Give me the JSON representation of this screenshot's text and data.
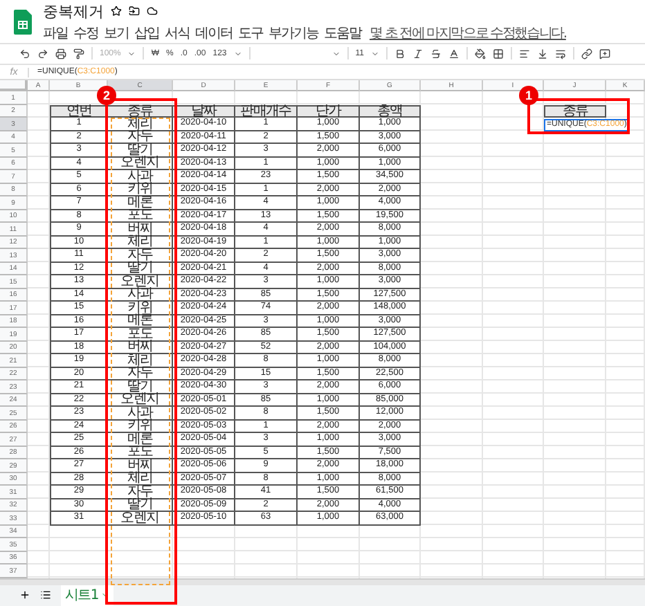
{
  "document": {
    "title": "중복제거"
  },
  "menu": [
    "파일",
    "수정",
    "보기",
    "삽입",
    "서식",
    "데이터",
    "도구",
    "부가기능",
    "도움말"
  ],
  "last_edit": "몇 초 전에 마지막으로 수정했습니다.",
  "toolbar": {
    "zoom": "100%",
    "currency": "₩",
    "percent": "%",
    "decrease_decimal": ".0",
    "increase_decimal": ".00",
    "number_format": "123",
    "font_size": "11"
  },
  "formula_bar": {
    "label": "fx",
    "formula": {
      "prefix": "=UNIQUE(",
      "range": "C3:C1000",
      "suffix": ")"
    }
  },
  "columns": [
    {
      "label": "A",
      "highlighted": false
    },
    {
      "label": "B",
      "highlighted": false
    },
    {
      "label": "C",
      "highlighted": true
    },
    {
      "label": "D",
      "highlighted": false
    },
    {
      "label": "E",
      "highlighted": false
    },
    {
      "label": "F",
      "highlighted": false
    },
    {
      "label": "G",
      "highlighted": false
    },
    {
      "label": "H",
      "highlighted": false
    },
    {
      "label": "I",
      "highlighted": false
    },
    {
      "label": "J",
      "highlighted": false
    },
    {
      "label": "K",
      "highlighted": false
    }
  ],
  "row_numbers": [
    {
      "label": "1",
      "highlighted": false
    },
    {
      "label": "2",
      "highlighted": false
    },
    {
      "label": "3",
      "highlighted": true
    },
    {
      "label": "4",
      "highlighted": false
    },
    {
      "label": "5",
      "highlighted": false
    },
    {
      "label": "6",
      "highlighted": false
    },
    {
      "label": "7",
      "highlighted": false
    },
    {
      "label": "8",
      "highlighted": false
    },
    {
      "label": "9",
      "highlighted": false
    },
    {
      "label": "10",
      "highlighted": false
    },
    {
      "label": "11",
      "highlighted": false
    },
    {
      "label": "12",
      "highlighted": false
    },
    {
      "label": "13",
      "highlighted": false
    },
    {
      "label": "14",
      "highlighted": false
    },
    {
      "label": "15",
      "highlighted": false
    },
    {
      "label": "16",
      "highlighted": false
    },
    {
      "label": "17",
      "highlighted": false
    },
    {
      "label": "18",
      "highlighted": false
    },
    {
      "label": "19",
      "highlighted": false
    },
    {
      "label": "20",
      "highlighted": false
    },
    {
      "label": "21",
      "highlighted": false
    },
    {
      "label": "22",
      "highlighted": false
    },
    {
      "label": "23",
      "highlighted": false
    },
    {
      "label": "24",
      "highlighted": false
    },
    {
      "label": "25",
      "highlighted": false
    },
    {
      "label": "26",
      "highlighted": false
    },
    {
      "label": "27",
      "highlighted": false
    },
    {
      "label": "28",
      "highlighted": false
    },
    {
      "label": "29",
      "highlighted": false
    },
    {
      "label": "30",
      "highlighted": false
    },
    {
      "label": "31",
      "highlighted": false
    },
    {
      "label": "32",
      "highlighted": false
    },
    {
      "label": "33",
      "highlighted": false
    },
    {
      "label": "34",
      "highlighted": false
    },
    {
      "label": "35",
      "highlighted": false
    },
    {
      "label": "36",
      "highlighted": false
    },
    {
      "label": "37",
      "highlighted": false
    }
  ],
  "table": {
    "columns": [
      "연번",
      "종류",
      "날짜",
      "판매개수",
      "단가",
      "총액"
    ],
    "rows": [
      [
        "1",
        "체리",
        "2020-04-10",
        "1",
        "1,000",
        "1,000"
      ],
      [
        "2",
        "자두",
        "2020-04-11",
        "2",
        "1,500",
        "3,000"
      ],
      [
        "3",
        "딸기",
        "2020-04-12",
        "3",
        "2,000",
        "6,000"
      ],
      [
        "4",
        "오렌지",
        "2020-04-13",
        "1",
        "1,000",
        "1,000"
      ],
      [
        "5",
        "사과",
        "2020-04-14",
        "23",
        "1,500",
        "34,500"
      ],
      [
        "6",
        "키위",
        "2020-04-15",
        "1",
        "2,000",
        "2,000"
      ],
      [
        "7",
        "메론",
        "2020-04-16",
        "4",
        "1,000",
        "4,000"
      ],
      [
        "8",
        "포도",
        "2020-04-17",
        "13",
        "1,500",
        "19,500"
      ],
      [
        "9",
        "버찌",
        "2020-04-18",
        "4",
        "2,000",
        "8,000"
      ],
      [
        "10",
        "체리",
        "2020-04-19",
        "1",
        "1,000",
        "1,000"
      ],
      [
        "11",
        "자두",
        "2020-04-20",
        "2",
        "1,500",
        "3,000"
      ],
      [
        "12",
        "딸기",
        "2020-04-21",
        "4",
        "2,000",
        "8,000"
      ],
      [
        "13",
        "오렌지",
        "2020-04-22",
        "3",
        "1,000",
        "3,000"
      ],
      [
        "14",
        "사과",
        "2020-04-23",
        "85",
        "1,500",
        "127,500"
      ],
      [
        "15",
        "키위",
        "2020-04-24",
        "74",
        "2,000",
        "148,000"
      ],
      [
        "16",
        "메론",
        "2020-04-25",
        "3",
        "1,000",
        "3,000"
      ],
      [
        "17",
        "포도",
        "2020-04-26",
        "85",
        "1,500",
        "127,500"
      ],
      [
        "18",
        "버찌",
        "2020-04-27",
        "52",
        "2,000",
        "104,000"
      ],
      [
        "19",
        "체리",
        "2020-04-28",
        "8",
        "1,000",
        "8,000"
      ],
      [
        "20",
        "자두",
        "2020-04-29",
        "15",
        "1,500",
        "22,500"
      ],
      [
        "21",
        "딸기",
        "2020-04-30",
        "3",
        "2,000",
        "6,000"
      ],
      [
        "22",
        "오렌지",
        "2020-05-01",
        "85",
        "1,000",
        "85,000"
      ],
      [
        "23",
        "사과",
        "2020-05-02",
        "8",
        "1,500",
        "12,000"
      ],
      [
        "24",
        "키위",
        "2020-05-03",
        "1",
        "2,000",
        "2,000"
      ],
      [
        "25",
        "메론",
        "2020-05-04",
        "3",
        "1,000",
        "3,000"
      ],
      [
        "26",
        "포도",
        "2020-05-05",
        "5",
        "1,500",
        "7,500"
      ],
      [
        "27",
        "버찌",
        "2020-05-06",
        "9",
        "2,000",
        "18,000"
      ],
      [
        "28",
        "체리",
        "2020-05-07",
        "8",
        "1,000",
        "8,000"
      ],
      [
        "29",
        "자두",
        "2020-05-08",
        "41",
        "1,500",
        "61,500"
      ],
      [
        "30",
        "딸기",
        "2020-05-09",
        "2",
        "2,000",
        "4,000"
      ],
      [
        "31",
        "오렌지",
        "2020-05-10",
        "63",
        "1,000",
        "63,000"
      ]
    ]
  },
  "unique_result": {
    "header": "종류",
    "selected": true,
    "formula": {
      "prefix": "=UNIQUE(",
      "range": "C3:C1000",
      "suffix": ")"
    }
  },
  "callouts": [
    {
      "number": "2"
    },
    {
      "number": "1"
    }
  ],
  "sheet_tabs": [
    {
      "label": "시트1",
      "selected": true
    }
  ]
}
